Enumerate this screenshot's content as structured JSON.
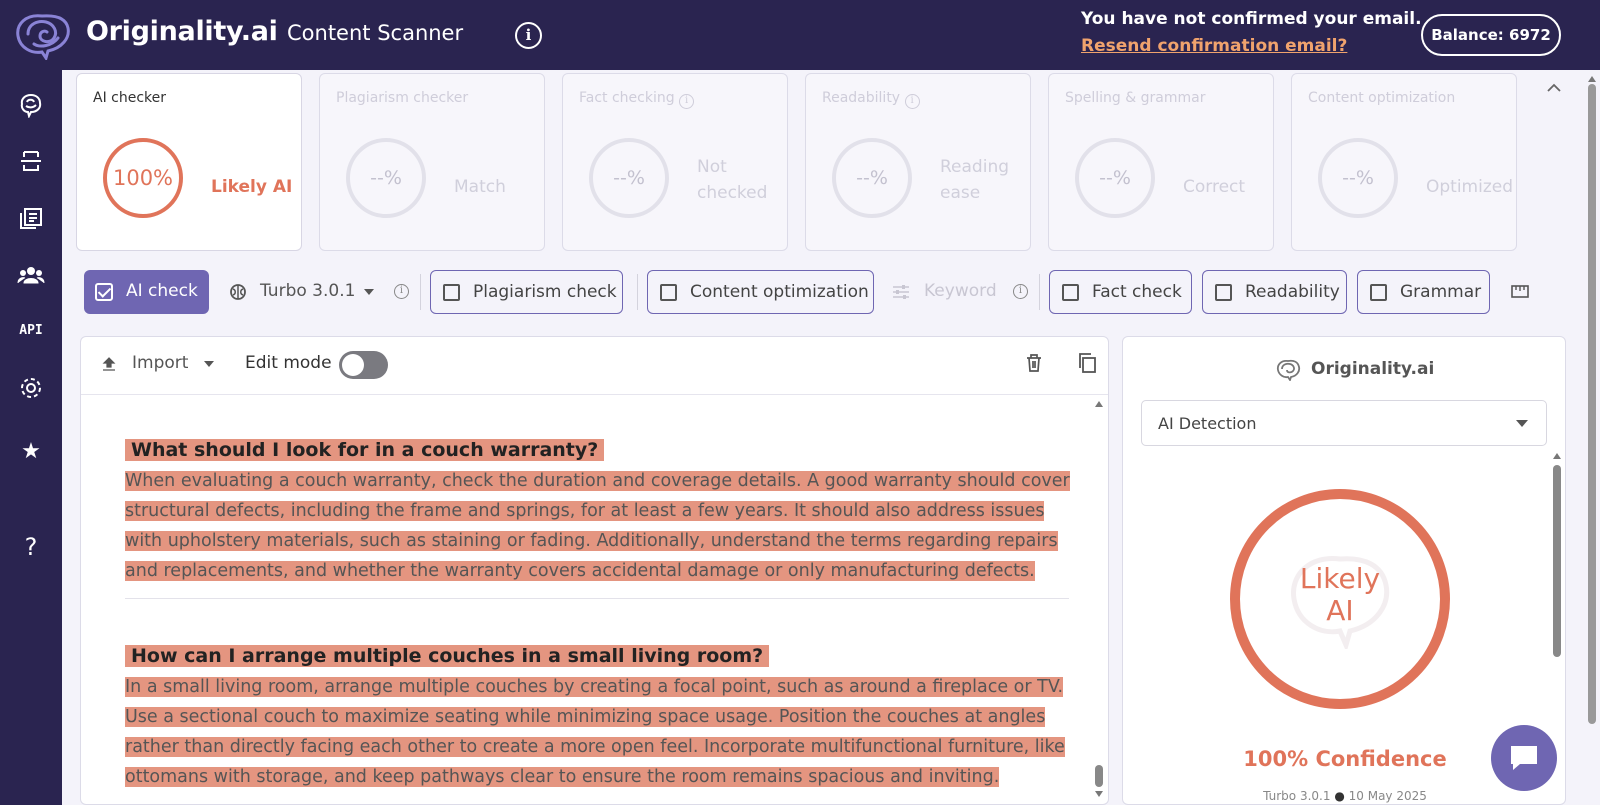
{
  "header": {
    "brand": "Originality.ai",
    "app_title": "Content Scanner",
    "email_notice": "You have not confirmed your email.",
    "resend_link": "Resend confirmation email?",
    "balance": "Balance: 6972"
  },
  "colors": {
    "nav_bg": "#2a2450",
    "accent": "#6f66b2",
    "ai_orange": "#e0745a",
    "highlight": "#e49580",
    "link": "#f0a36d"
  },
  "sidebar": {
    "items": [
      {
        "icon": "brain-icon"
      },
      {
        "icon": "scan-document-icon"
      },
      {
        "icon": "library-icon"
      },
      {
        "icon": "team-icon"
      },
      {
        "label": "API"
      },
      {
        "icon": "gear-icon"
      },
      {
        "icon": "star-icon"
      },
      {
        "label": "?"
      }
    ]
  },
  "cards": [
    {
      "title": "AI checker",
      "value": "100%",
      "status": "Likely AI"
    },
    {
      "title": "Plagiarism checker",
      "value": "--%",
      "status": "Match"
    },
    {
      "title": "Fact checking",
      "value": "--%",
      "status_line1": "Not",
      "status_line2": "checked"
    },
    {
      "title": "Readability",
      "value": "--%",
      "status_line1": "Reading",
      "status_line2": "ease"
    },
    {
      "title": "Spelling & grammar",
      "value": "--%",
      "status": "Correct"
    },
    {
      "title": "Content optimization",
      "value": "--%",
      "status": "Optimized"
    }
  ],
  "toolbar": {
    "ai_check": "AI check",
    "model": "Turbo 3.0.1",
    "plagiarism_check": "Plagiarism check",
    "content_optimization": "Content optimization",
    "keyword": "Keyword",
    "fact_check": "Fact check",
    "readability": "Readability",
    "grammar": "Grammar"
  },
  "editor": {
    "import_label": "Import",
    "edit_mode_label": "Edit mode",
    "edit_mode_on": false,
    "blocks": [
      {
        "heading": "What should I look for in a couch warranty?",
        "lines": [
          "When evaluating a couch warranty, check the duration and coverage details.  A good warranty should cover",
          "structural defects, including the frame and springs, for at least a few years.  It should also address issues",
          "with upholstery materials, such as staining or fading.  Additionally, understand the terms regarding repairs",
          "and replacements, and whether the warranty covers accidental damage or only manufacturing defects."
        ]
      },
      {
        "heading": "How can I arrange multiple couches in a small living room?",
        "lines": [
          "In a small living room, arrange multiple couches by creating a focal point, such as around a fireplace or TV.",
          "Use a sectional couch to maximize seating while minimizing space usage.  Position the couches at angles",
          "rather than directly facing each other to create a more open feel.  Incorporate multifunctional furniture, like",
          "ottomans with storage, and keep pathways clear to ensure the room remains spacious and inviting."
        ]
      }
    ]
  },
  "result": {
    "brand": "Originality.ai",
    "mode": "AI Detection",
    "verdict_line1": "Likely",
    "verdict_line2": "AI",
    "confidence": "100% Confidence",
    "model": "Turbo 3.0.1",
    "date": "10 May 2025"
  }
}
